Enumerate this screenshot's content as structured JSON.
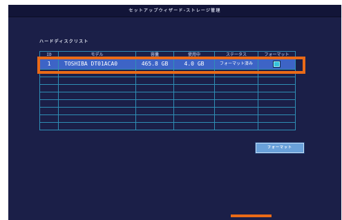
{
  "window": {
    "title": "セットアップウィザード-ストレージ管理"
  },
  "section": {
    "label": "ハードディスクリスト"
  },
  "table": {
    "headers": [
      "ID",
      "モデル",
      "容量",
      "使用中",
      "ステータス",
      "フォーマット"
    ],
    "rows": [
      {
        "id": "1",
        "model": "TOSHIBA DT01ACA0",
        "capacity": "465.8 GB",
        "used": "4.0 GB",
        "status": "フォーマット済み",
        "format_checked": true
      }
    ],
    "empty_rows": 8
  },
  "buttons": {
    "format_label": "フォーマット"
  },
  "colors": {
    "background": "#1b1f48",
    "selected_row": "#3d64c6",
    "grid_line": "#2f8fb6",
    "highlight": "#ea6a17",
    "button": "#6aa1da"
  },
  "icons": {
    "format_checkbox": "checkbox-icon"
  }
}
